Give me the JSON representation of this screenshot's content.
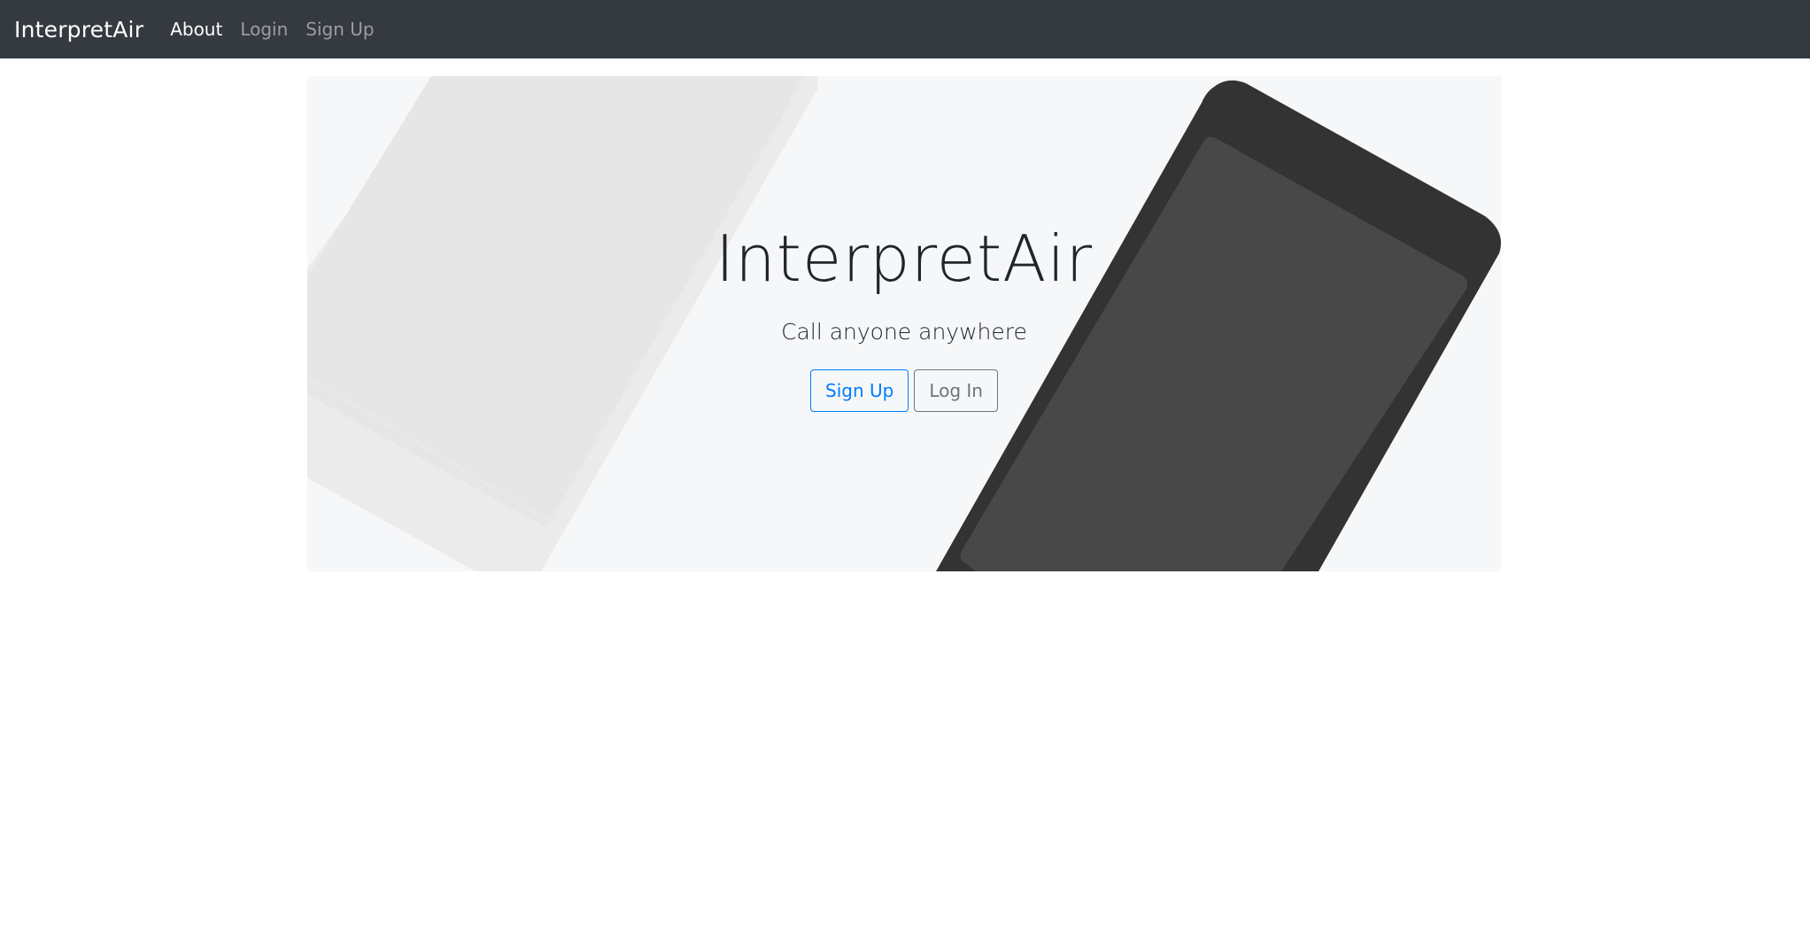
{
  "navbar": {
    "brand": "InterpretAir",
    "links": [
      {
        "label": "About",
        "active": true
      },
      {
        "label": "Login",
        "active": false
      },
      {
        "label": "Sign Up",
        "active": false
      }
    ]
  },
  "hero": {
    "title": "InterpretAir",
    "subtitle": "Call anyone anywhere",
    "signup_label": "Sign Up",
    "login_label": "Log In"
  },
  "colors": {
    "navbar_bg": "#343a40",
    "hero_bg": "#f6f7f9",
    "primary": "#007bff",
    "secondary": "#6c757d",
    "phone_dark": "#333333",
    "phone_screen": "#484848",
    "phone_light": "#e6e6e6"
  }
}
